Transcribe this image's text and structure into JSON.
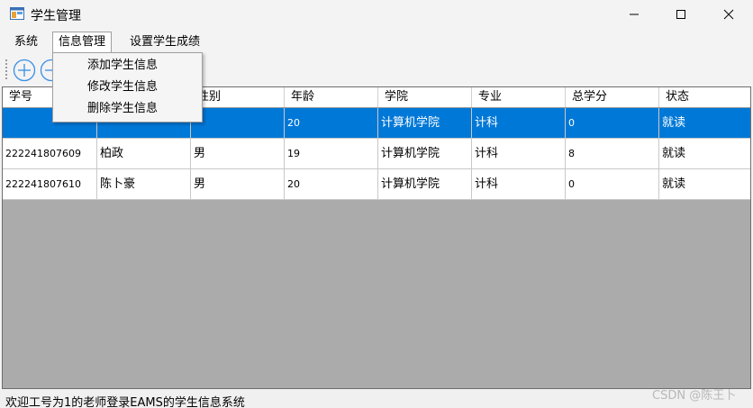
{
  "window": {
    "title": "学生管理"
  },
  "menu": {
    "system": "系统",
    "info_manage": "信息管理",
    "set_score": "设置学生成绩"
  },
  "dropdown": {
    "add": "添加学生信息",
    "edit": "修改学生信息",
    "delete": "删除学生信息"
  },
  "grid": {
    "columns": [
      "学号",
      "",
      "性别",
      "年龄",
      "学院",
      "专业",
      "总学分",
      "状态"
    ],
    "rows": [
      [
        "222241807609",
        "柏政",
        "男",
        "19",
        "计算机学院",
        "计科",
        "8",
        "就读"
      ],
      [
        "222241807610",
        "陈卜豪",
        "男",
        "20",
        "计算机学院",
        "计科",
        "0",
        "就读"
      ]
    ],
    "selected_row": [
      "",
      "",
      "",
      "20",
      "计算机学院",
      "计科",
      "0",
      "就读"
    ]
  },
  "status": {
    "text": "欢迎工号为1的老师登录EAMS的学生信息系统"
  },
  "watermark": "CSDN @陈王卜",
  "colors": {
    "selection": "#0078d7",
    "grid_background": "#ababab",
    "window": "#f3f3f3"
  }
}
